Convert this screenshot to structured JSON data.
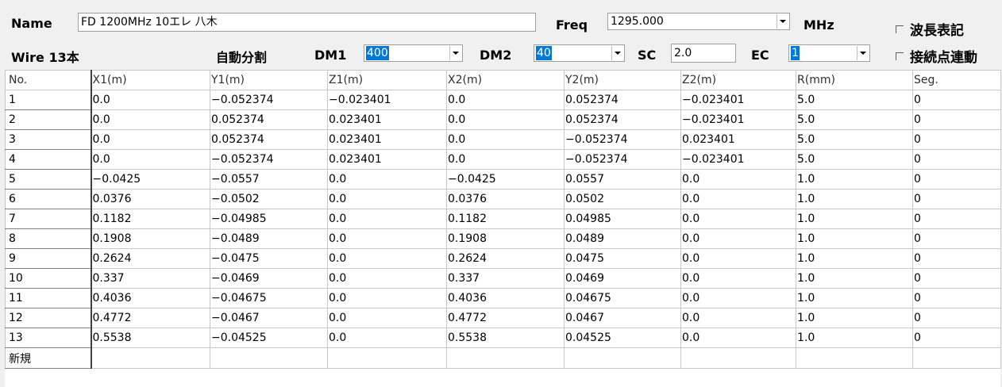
{
  "header": {
    "name_label": "Name",
    "name_value": "FD 1200MHz 10エレ 八木",
    "freq_label": "Freq",
    "freq_value": "1295.000",
    "freq_unit": "MHz",
    "wavelength_label": "波長表記",
    "wire_count_label": "Wire 13本",
    "auto_split_label": "自動分割",
    "dm1_label": "DM1",
    "dm1_value": "400",
    "dm2_label": "DM2",
    "dm2_value": "40",
    "sc_label": "SC",
    "sc_value": "2.0",
    "ec_label": "EC",
    "ec_value": "1",
    "link_label": "接続点連動"
  },
  "table": {
    "columns": [
      "No.",
      "X1(m)",
      "Y1(m)",
      "Z1(m)",
      "X2(m)",
      "Y2(m)",
      "Z2(m)",
      "R(mm)",
      "Seg."
    ],
    "rows": [
      [
        "1",
        "0.0",
        "−0.052374",
        "−0.023401",
        "0.0",
        "0.052374",
        "−0.023401",
        "5.0",
        "0"
      ],
      [
        "2",
        "0.0",
        "0.052374",
        "0.023401",
        "0.0",
        "0.052374",
        "−0.023401",
        "5.0",
        "0"
      ],
      [
        "3",
        "0.0",
        "0.052374",
        "0.023401",
        "0.0",
        "−0.052374",
        "0.023401",
        "5.0",
        "0"
      ],
      [
        "4",
        "0.0",
        "−0.052374",
        "0.023401",
        "0.0",
        "−0.052374",
        "−0.023401",
        "5.0",
        "0"
      ],
      [
        "5",
        "−0.0425",
        "−0.0557",
        "0.0",
        "−0.0425",
        "0.0557",
        "0.0",
        "1.0",
        "0"
      ],
      [
        "6",
        "0.0376",
        "−0.0502",
        "0.0",
        "0.0376",
        "0.0502",
        "0.0",
        "1.0",
        "0"
      ],
      [
        "7",
        "0.1182",
        "−0.04985",
        "0.0",
        "0.1182",
        "0.04985",
        "0.0",
        "1.0",
        "0"
      ],
      [
        "8",
        "0.1908",
        "−0.0489",
        "0.0",
        "0.1908",
        "0.0489",
        "0.0",
        "1.0",
        "0"
      ],
      [
        "9",
        "0.2624",
        "−0.0475",
        "0.0",
        "0.2624",
        "0.0475",
        "0.0",
        "1.0",
        "0"
      ],
      [
        "10",
        "0.337",
        "−0.0469",
        "0.0",
        "0.337",
        "0.0469",
        "0.0",
        "1.0",
        "0"
      ],
      [
        "11",
        "0.4036",
        "−0.04675",
        "0.0",
        "0.4036",
        "0.04675",
        "0.0",
        "1.0",
        "0"
      ],
      [
        "12",
        "0.4772",
        "−0.0467",
        "0.0",
        "0.4772",
        "0.0467",
        "0.0",
        "1.0",
        "0"
      ],
      [
        "13",
        "0.5538",
        "−0.04525",
        "0.0",
        "0.5538",
        "0.04525",
        "0.0",
        "1.0",
        "0"
      ]
    ],
    "new_row_label": "新規"
  }
}
